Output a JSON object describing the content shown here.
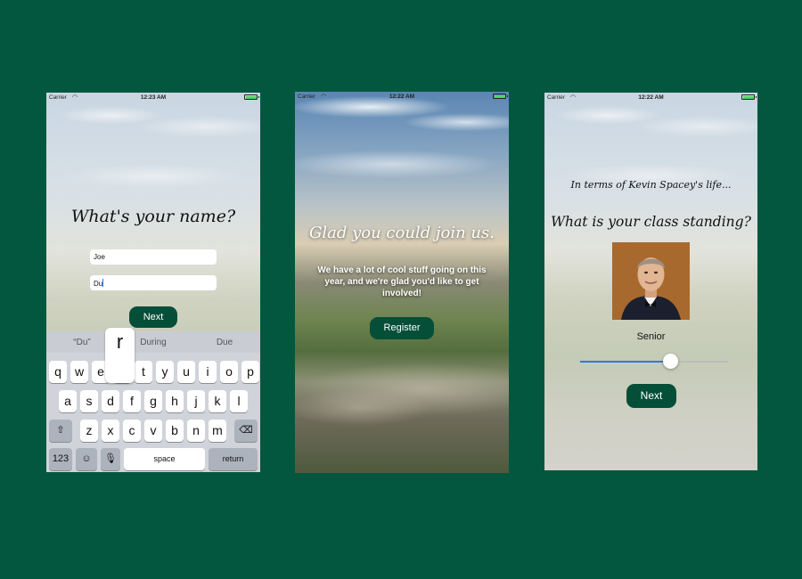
{
  "status_bar": {
    "carrier": "Carrier",
    "screen1_time": "12:23 AM",
    "screen2_time": "12:22 AM",
    "screen3_time": "12:22 AM",
    "battery_color": "#4cd964"
  },
  "screen1": {
    "title": "What's your name?",
    "first_name_value": "Joe",
    "last_name_value": "Du",
    "next_button": "Next",
    "keyboard": {
      "suggestions": [
        "“Du”",
        "During",
        "Due"
      ],
      "popup_key": "r",
      "row1": [
        "q",
        "w",
        "e",
        "r",
        "t",
        "y",
        "u",
        "i",
        "o",
        "p"
      ],
      "row2": [
        "a",
        "s",
        "d",
        "f",
        "g",
        "h",
        "j",
        "k",
        "l"
      ],
      "row3": [
        "z",
        "x",
        "c",
        "v",
        "b",
        "n",
        "m"
      ],
      "shift_icon": "⇧",
      "delete_icon": "⌫",
      "numbers_key": "123",
      "emoji_icon": "☺",
      "mic_icon": "🎙",
      "space_key": "space",
      "return_key": "return"
    }
  },
  "screen2": {
    "title": "Glad you could join us.",
    "message": "We have a lot of cool stuff going on this year, and we're glad you'd like to get involved!",
    "register_button": "Register"
  },
  "screen3": {
    "intro": "In terms of Kevin Spacey's life...",
    "question": "What is your class standing?",
    "slider_label": "Senior",
    "slider_value": 0.61,
    "next_button": "Next"
  },
  "colors": {
    "page_background": "#04573f",
    "button_green": "#054f38",
    "slider_accent": "#2f7ae0"
  }
}
